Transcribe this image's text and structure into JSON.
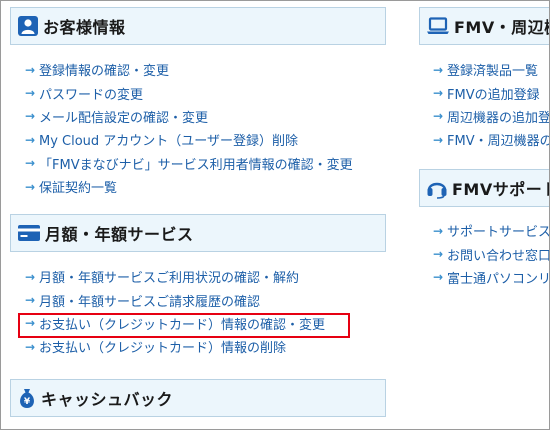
{
  "sections": {
    "customer": {
      "title": "お客様情報",
      "icon": "person-icon",
      "links": [
        "登録情報の確認・変更",
        "パスワードの変更",
        "メール配信設定の確認・変更",
        "My Cloud アカウント（ユーザー登録）削除",
        "「FMVまなびナビ」サービス利用者情報の確認・変更",
        "保証契約一覧"
      ]
    },
    "monthly": {
      "title": "月額・年額サービス",
      "icon": "credit-card-icon",
      "links": [
        "月額・年額サービスご利用状況の確認・解約",
        "月額・年額サービスご請求履歴の確認",
        "お支払い（クレジットカード）情報の確認・変更",
        "お支払い（クレジットカード）情報の削除"
      ],
      "highlighted_index": 2
    },
    "cashback": {
      "title": "キャッシュバック",
      "icon": "money-bag-icon"
    },
    "fmv_devices": {
      "title": "FMV・周辺機",
      "icon": "laptop-icon",
      "links": [
        "登録済製品一覧",
        "FMVの追加登録",
        "周辺機器の追加登録",
        "FMV・周辺機器の"
      ]
    },
    "fmv_support": {
      "title": "FMVサポート",
      "icon": "headset-icon",
      "links": [
        "サポートサービス",
        "お問い合わせ窓口",
        "富士通パソコンリ"
      ]
    }
  },
  "colors": {
    "header_bg": "#ecf6fc",
    "header_border": "#b9d2e3",
    "link": "#1d5fa8",
    "arrow": "#3a8fcd",
    "icon_blue": "#1e63b5",
    "highlight": "#e60012"
  }
}
